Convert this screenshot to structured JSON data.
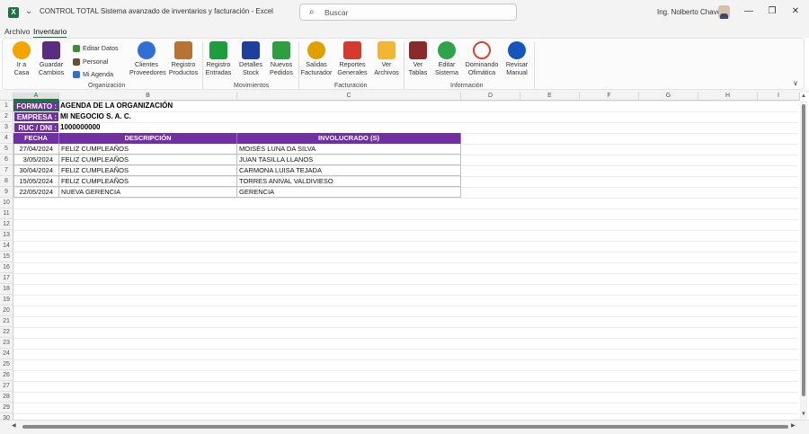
{
  "app": {
    "title": "CONTROL TOTAL Sistema avanzado de inventarios y facturación  -  Excel",
    "logo_letter": "X",
    "search_placeholder": "Buscar",
    "user": "Ing. Nolberto Chavez",
    "minimize": "—",
    "restore": "❐",
    "close": "✕"
  },
  "menu": {
    "tabs": [
      "Archivo",
      "Inventario"
    ],
    "active": "Inventario"
  },
  "ribbon": {
    "buttons": [
      {
        "id": "ir-a-casa",
        "line1": "Ir a",
        "line2": "Casa",
        "color": "#f4a300"
      },
      {
        "id": "guardar-cambios",
        "line1": "Guardar",
        "line2": "Cambios",
        "color": "#5a2d82"
      },
      {
        "id": "clientes-proveedores",
        "line1": "Clientes",
        "line2": "Proveedores",
        "color": "#2f6fd6"
      },
      {
        "id": "registro-productos",
        "line1": "Registro",
        "line2": "Productos",
        "color": "#b87333"
      },
      {
        "id": "registro-entradas",
        "line1": "Registro",
        "line2": "Entradas",
        "color": "#1f9d3a"
      },
      {
        "id": "detalles-stock",
        "line1": "Detalles",
        "line2": "Stock",
        "color": "#1f3fa0"
      },
      {
        "id": "nuevos-pedidos",
        "line1": "Nuevos",
        "line2": "Pedidos",
        "color": "#2e9e40"
      },
      {
        "id": "salidas-facturador",
        "line1": "Salidas",
        "line2": "Facturador",
        "color": "#e0a000"
      },
      {
        "id": "reportes-generales",
        "line1": "Reportes",
        "line2": "Generales",
        "color": "#d63a2f"
      },
      {
        "id": "ver-archivos",
        "line1": "Ver",
        "line2": "Archivos",
        "color": "#f2b632"
      },
      {
        "id": "ver-tablas",
        "line1": "Ver",
        "line2": "Tablas",
        "color": "#8b2a2a"
      },
      {
        "id": "editar-sistema",
        "line1": "Editar",
        "line2": "Sistema",
        "color": "#2fa34a"
      },
      {
        "id": "dominando-ofimatica",
        "line1": "Dominando",
        "line2": "Ofimática",
        "color": "#d8452e"
      },
      {
        "id": "revisar-manual",
        "line1": "Revisar",
        "line2": "Manual",
        "color": "#1555c0"
      }
    ],
    "small_buttons": [
      {
        "id": "editar-datos",
        "label": "Editar Datos",
        "color": "#3b8d3b"
      },
      {
        "id": "personal",
        "label": "Personal",
        "color": "#6b4c2e"
      },
      {
        "id": "mi-agenda",
        "label": "Mi Agenda",
        "color": "#2f6fd6"
      }
    ],
    "groups": [
      "Organización",
      "Movimientos",
      "Facturación",
      "Información"
    ],
    "collapse": "∨"
  },
  "sheet": {
    "columns": [
      "A",
      "B",
      "C",
      "D",
      "E",
      "F",
      "G",
      "H",
      "I"
    ],
    "rows": [
      "1",
      "2",
      "3",
      "4",
      "5",
      "6",
      "7",
      "8",
      "9",
      "10",
      "11",
      "12",
      "13",
      "14",
      "15",
      "16",
      "17",
      "18",
      "19",
      "20",
      "21",
      "22",
      "23",
      "24",
      "25",
      "26",
      "27",
      "28",
      "29",
      "30"
    ],
    "header_info": {
      "formato_label": "FORMATO :",
      "formato_value": "AGENDA DE LA ORGANIZACIÓN",
      "empresa_label": "EMPRESA :",
      "empresa_value": "MI NEGOCIO S. A. C.",
      "ruc_label": "RUC / DNI :",
      "ruc_value": "1000000000"
    },
    "table_headers": [
      "FECHA",
      "DESCRIPCIÓN",
      "INVOLUCRADO (S)"
    ],
    "table_rows": [
      [
        "27/04/2024",
        "FELIZ CUMPLEAÑOS",
        "MOISÉS LUNA DA SILVA"
      ],
      [
        "3/05/2024",
        "FELIZ CUMPLEAÑOS",
        "JUAN TASILLA LLANOS"
      ],
      [
        "30/04/2024",
        "FELIZ CUMPLEAÑOS",
        "CARMONA LUISA TEJADA"
      ],
      [
        "15/05/2024",
        "FELIZ CUMPLEAÑOS",
        "TORRES ANIVAL VALDIVIESO"
      ],
      [
        "22/05/2024",
        "NUEVA GERENCIA",
        "GERENCIA"
      ]
    ]
  }
}
